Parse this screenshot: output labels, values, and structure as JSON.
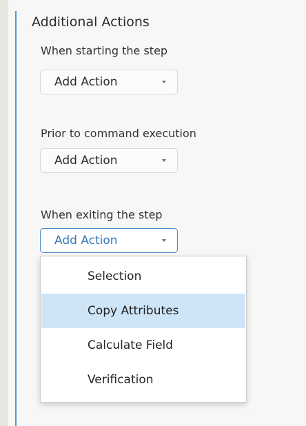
{
  "section": {
    "title": "Additional Actions"
  },
  "actions": [
    {
      "label": "When starting the step",
      "button_label": "Add Action"
    },
    {
      "label": "Prior to command execution",
      "button_label": "Add Action"
    },
    {
      "label": "When exiting the step",
      "button_label": "Add Action"
    }
  ],
  "menu": {
    "items": [
      {
        "label": "Selection"
      },
      {
        "label": "Copy Attributes"
      },
      {
        "label": "Calculate Field"
      },
      {
        "label": "Verification"
      }
    ]
  },
  "colors": {
    "accent": "#4f9ad3",
    "highlight": "#cde5f7",
    "active_border": "#4b88c7"
  },
  "icons": {
    "dropdown": "chevron-down-icon"
  }
}
